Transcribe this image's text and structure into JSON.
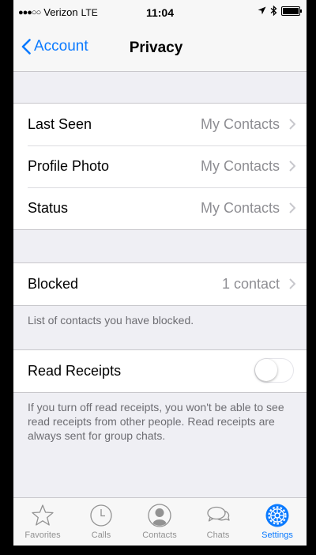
{
  "status_bar": {
    "signal": "●●●○○",
    "carrier": "Verizon",
    "network": "LTE",
    "time": "11:04"
  },
  "navbar": {
    "back_label": "Account",
    "title": "Privacy"
  },
  "privacy_group": {
    "rows": [
      {
        "label": "Last Seen",
        "value": "My Contacts"
      },
      {
        "label": "Profile Photo",
        "value": "My Contacts"
      },
      {
        "label": "Status",
        "value": "My Contacts"
      }
    ]
  },
  "blocked": {
    "label": "Blocked",
    "value": "1 contact",
    "footer": "List of contacts you have blocked."
  },
  "read_receipts": {
    "label": "Read Receipts",
    "enabled": false,
    "footer": "If you turn off read receipts, you won't be able to see read receipts from other people. Read receipts are always sent for group chats."
  },
  "tabbar": {
    "tabs": [
      {
        "label": "Favorites",
        "icon": "star-icon",
        "active": false
      },
      {
        "label": "Calls",
        "icon": "clock-icon",
        "active": false
      },
      {
        "label": "Contacts",
        "icon": "person-icon",
        "active": false
      },
      {
        "label": "Chats",
        "icon": "chat-bubbles-icon",
        "active": false
      },
      {
        "label": "Settings",
        "icon": "gear-icon",
        "active": true
      }
    ]
  },
  "colors": {
    "accent": "#0a7aff",
    "background": "#efeff4",
    "secondary_text": "#8e8e93"
  }
}
